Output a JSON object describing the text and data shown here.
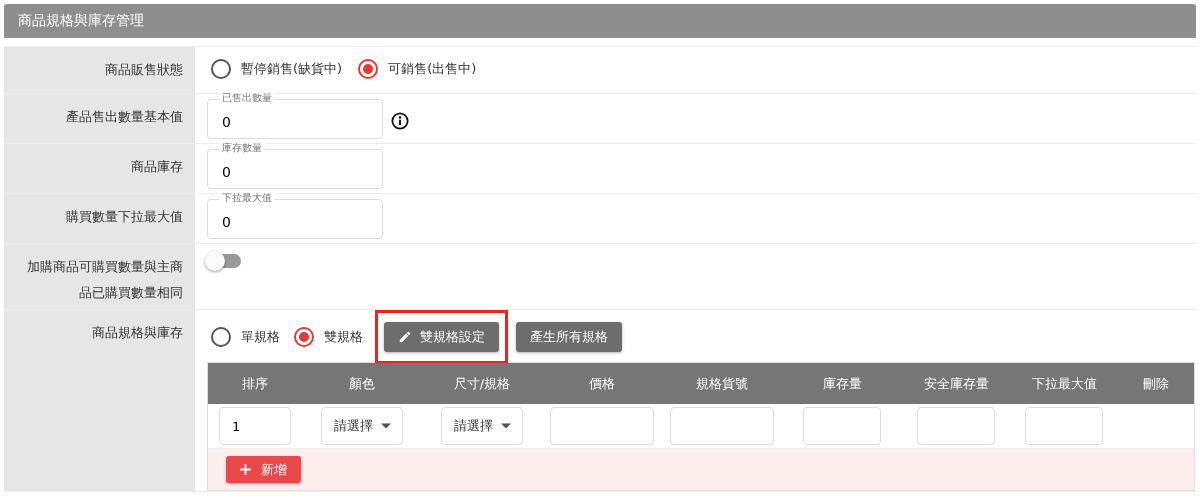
{
  "header": {
    "title": "商品規格與庫存管理"
  },
  "rows": [
    {
      "kind": "radio",
      "label": "商品販售狀態",
      "options": [
        {
          "label": "暫停銷售(缺貨中)",
          "selected": false
        },
        {
          "label": "可銷售(出售中)",
          "selected": true
        }
      ]
    },
    {
      "kind": "field",
      "label": "產品售出數量基本值",
      "field_label": "已售出數量",
      "value": "0",
      "info": true
    },
    {
      "kind": "field",
      "label": "商品庫存",
      "field_label": "庫存數量",
      "value": "0",
      "info": false
    },
    {
      "kind": "field",
      "label": "購買數量下拉最大值",
      "field_label": "下拉最大值",
      "value": "0",
      "info": false
    },
    {
      "kind": "toggle",
      "label": "加購商品可購買數量與主商品已購買數量相同",
      "on": false
    }
  ],
  "spec": {
    "label": "商品規格與庫存",
    "options": [
      {
        "label": "單規格",
        "selected": false
      },
      {
        "label": "雙規格",
        "selected": true
      }
    ],
    "buttons": [
      {
        "label": "雙規格設定",
        "highlighted": true
      },
      {
        "label": "產生所有規格",
        "highlighted": false
      }
    ],
    "columns": [
      "排序",
      "顏色",
      "尺寸/規格",
      "價格",
      "規格貨號",
      "庫存量",
      "安全庫存量",
      "下拉最大值",
      "刪除"
    ],
    "row": [
      {
        "kind": "input",
        "value": "1"
      },
      {
        "kind": "select",
        "value": "請選擇"
      },
      {
        "kind": "select",
        "value": "請選擇"
      },
      {
        "kind": "input"
      },
      {
        "kind": "input"
      },
      {
        "kind": "input"
      },
      {
        "kind": "input"
      },
      {
        "kind": "input"
      },
      {
        "kind": "none"
      }
    ],
    "add_button": "新增"
  }
}
